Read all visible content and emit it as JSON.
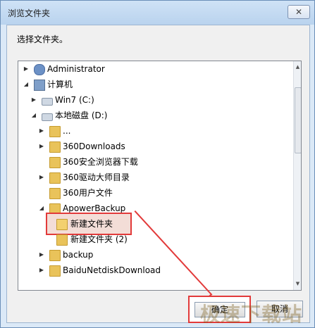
{
  "window": {
    "title": "浏览文件夹",
    "close_label": "✕"
  },
  "dialog": {
    "prompt": "选择文件夹。"
  },
  "tree": {
    "items": [
      {
        "label": "Administrator",
        "arrow": "▶",
        "icon": "user-icon"
      },
      {
        "label": "计算机",
        "arrow": "◢",
        "icon": "computer-icon"
      },
      {
        "label": "Win7 (C:)",
        "arrow": "▶",
        "icon": "disk-icon"
      },
      {
        "label": "本地磁盘 (D:)",
        "arrow": "◢",
        "icon": "disk-icon"
      },
      {
        "label": "...",
        "arrow": "▶",
        "icon": "folder-icon"
      },
      {
        "label": "360Downloads",
        "arrow": "▶",
        "icon": "folder-icon"
      },
      {
        "label": "360安全浏览器下载",
        "arrow": "",
        "icon": "folder-icon"
      },
      {
        "label": "360驱动大师目录",
        "arrow": "▶",
        "icon": "folder-icon"
      },
      {
        "label": "360用户文件",
        "arrow": "",
        "icon": "folder-icon"
      },
      {
        "label": "ApowerBackup",
        "arrow": "◢",
        "icon": "folder-icon"
      },
      {
        "label": "新建文件夹",
        "arrow": "",
        "icon": "folder-open-icon"
      },
      {
        "label": "新建文件夹 (2)",
        "arrow": "",
        "icon": "folder-icon"
      },
      {
        "label": "backup",
        "arrow": "▶",
        "icon": "folder-icon"
      },
      {
        "label": "BaiduNetdiskDownload",
        "arrow": "▶",
        "icon": "folder-icon"
      }
    ]
  },
  "buttons": {
    "ok": "确定",
    "cancel": "取消"
  },
  "watermark": "极速下载站"
}
